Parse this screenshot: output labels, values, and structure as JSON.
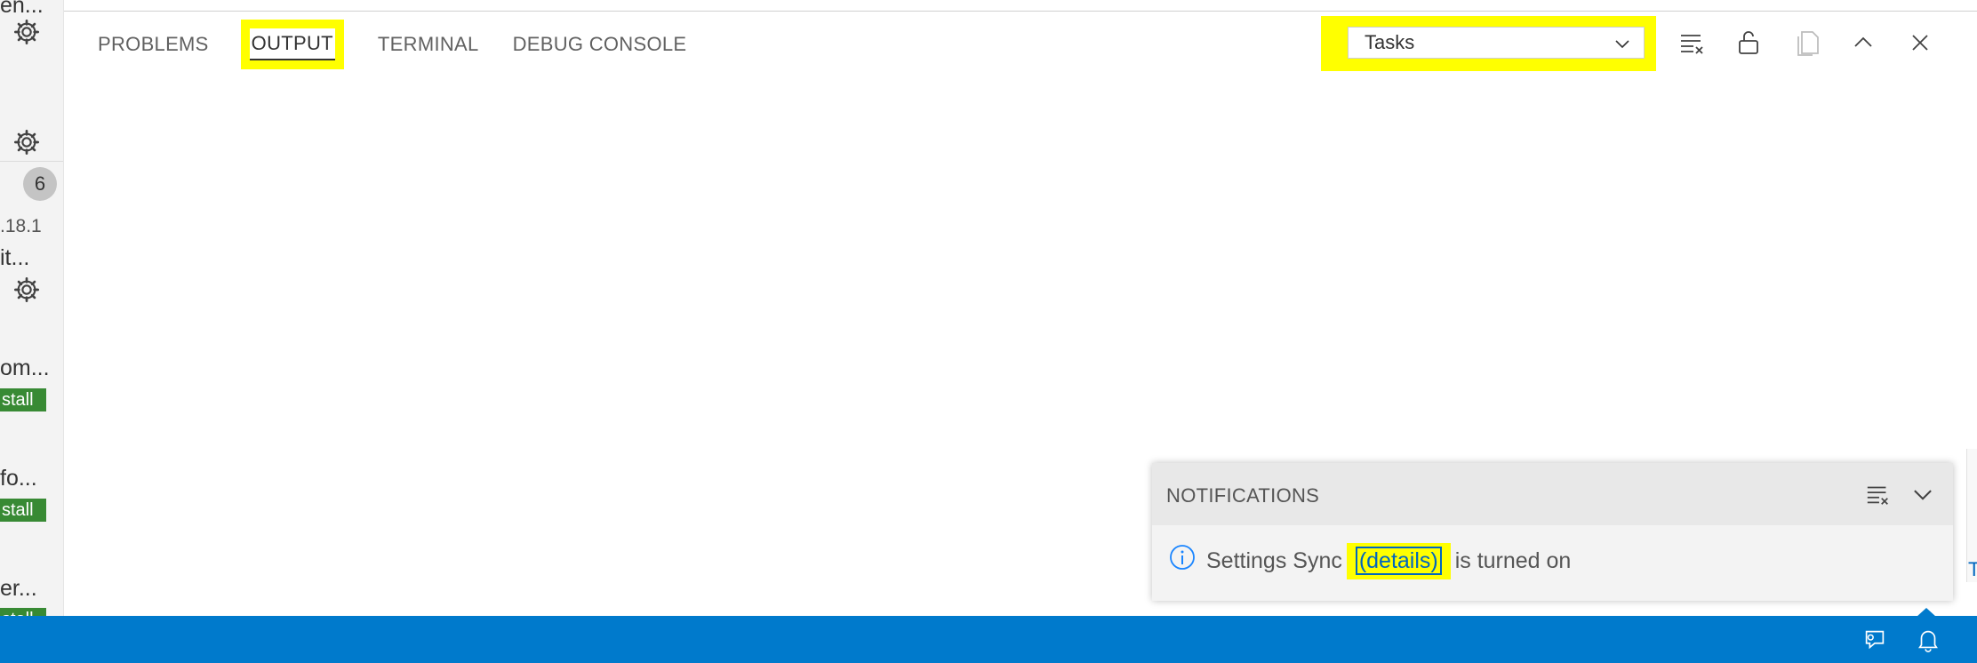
{
  "sidebar": {
    "truncated_texts": [
      "en...",
      "it...",
      "om...",
      "fo...",
      "er..."
    ],
    "version": ".18.1",
    "badge": "6",
    "install_label": "stall"
  },
  "panel": {
    "tabs": [
      "PROBLEMS",
      "OUTPUT",
      "TERMINAL",
      "DEBUG CONSOLE"
    ],
    "active_tab": "OUTPUT",
    "output_channel": "Tasks",
    "actions": [
      "clear-output",
      "lock-scroll",
      "open-in-editor",
      "maximize-panel",
      "close-panel"
    ]
  },
  "notifications": {
    "title": "NOTIFICATIONS",
    "message_prefix": "Settings Sync",
    "message_link": "(details)",
    "message_suffix": "is turned on"
  },
  "right_edge_char": "T",
  "colors": {
    "highlight": "#ffff00",
    "statusbar": "#007acc",
    "install": "#388a34",
    "link": "#0066bf"
  }
}
